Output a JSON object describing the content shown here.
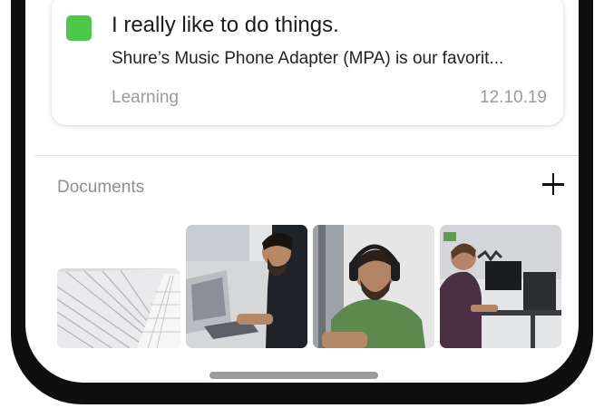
{
  "note": {
    "status_color": "#4cc84a",
    "status_icon": "green-square-icon",
    "title": "I really like to do things.",
    "excerpt": "Shure’s Music Phone Adapter (MPA) is our favorit...",
    "category": "Learning",
    "date": "12.10.19"
  },
  "documents": {
    "label": "Documents",
    "add_icon": "plus-icon",
    "thumbnails": [
      {
        "icon": "architecture-photo-thumbnail"
      },
      {
        "icon": "man-with-laptop-photo-thumbnail"
      },
      {
        "icon": "man-with-headphones-photo-thumbnail"
      },
      {
        "icon": "person-at-desk-photo-thumbnail"
      }
    ]
  },
  "colors": {
    "frame": "#0f0f10",
    "accent_green": "#4cc84a",
    "secondary_text": "#9a9a9f"
  }
}
